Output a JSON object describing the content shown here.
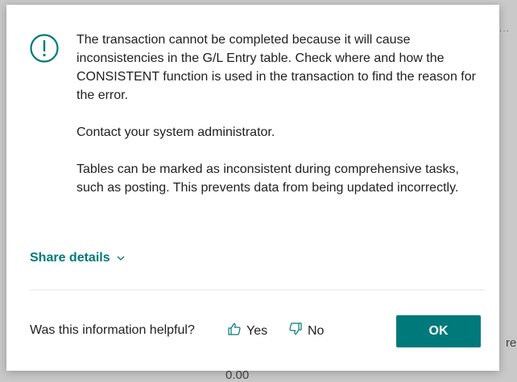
{
  "background": {
    "bottom_value": "0.00",
    "right_partial": "re"
  },
  "dialog": {
    "icon": "exclamation-circle-icon",
    "paragraphs": [
      "The transaction cannot be completed because it will cause inconsistencies in the G/L Entry table. Check where and how the CONSISTENT function is used in the transaction to find the reason for the error.",
      "Contact your system administrator.",
      "Tables can be marked as inconsistent during comprehensive tasks, such as posting. This prevents data from being updated incorrectly."
    ],
    "share_details": "Share details",
    "feedback": {
      "question": "Was this information helpful?",
      "yes": "Yes",
      "no": "No"
    },
    "ok_label": "OK"
  },
  "colors": {
    "accent": "#00797a",
    "text": "#212121",
    "overlay": "#c9c9c9"
  }
}
